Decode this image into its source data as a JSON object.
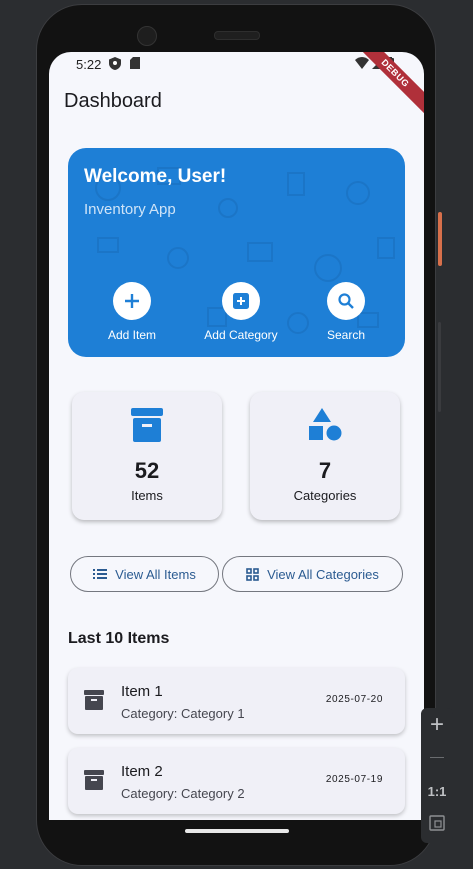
{
  "status": {
    "time": "5:22",
    "debug_banner": "DEBUG"
  },
  "appbar": {
    "title": "Dashboard"
  },
  "hero": {
    "title": "Welcome, User!",
    "subtitle": "Inventory App",
    "actions": [
      {
        "label": "Add Item",
        "icon": "plus-icon"
      },
      {
        "label": "Add Category",
        "icon": "add-box-icon"
      },
      {
        "label": "Search",
        "icon": "search-icon"
      }
    ],
    "color": "#1e7fd6"
  },
  "stats": [
    {
      "value": "52",
      "label": "Items",
      "icon": "archive-icon"
    },
    {
      "value": "7",
      "label": "Categories",
      "icon": "shapes-icon"
    }
  ],
  "buttons": {
    "view_items": "View All Items",
    "view_categories": "View All Categories"
  },
  "recent": {
    "title": "Last 10 Items",
    "items": [
      {
        "name": "Item 1",
        "category": "Category: Category 1",
        "date": "2025-07-20"
      },
      {
        "name": "Item 2",
        "category": "Category: Category 2",
        "date": "2025-07-19"
      }
    ]
  },
  "zoom_controls": {
    "plus": "+",
    "minus": "—",
    "reset": "1:1"
  }
}
